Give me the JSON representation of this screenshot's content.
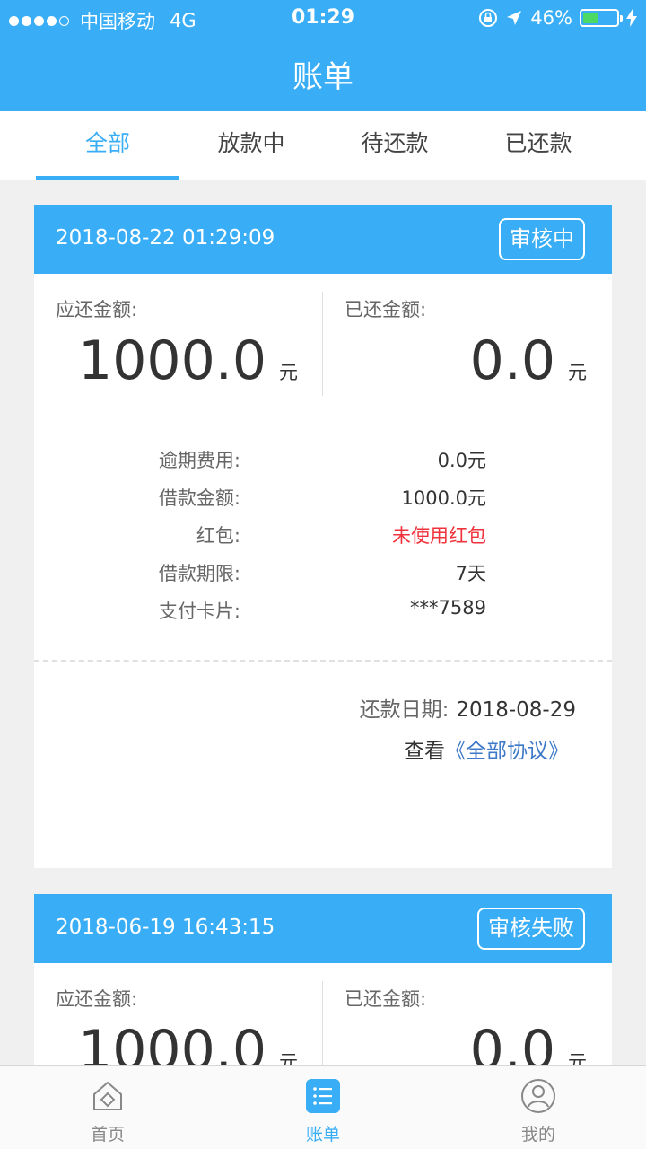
{
  "status_bar": {
    "carrier": "中国移动",
    "network": "4G",
    "time": "01:29",
    "battery": "46%"
  },
  "header": {
    "title": "账单"
  },
  "tabs": [
    {
      "label": "全部",
      "active": true
    },
    {
      "label": "放款中",
      "active": false
    },
    {
      "label": "待还款",
      "active": false
    },
    {
      "label": "已还款",
      "active": false
    }
  ],
  "bills": [
    {
      "datetime": "2018-08-22 01:29:09",
      "status": "审核中",
      "due_label": "应还金额:",
      "due_amount": "1000.0",
      "due_unit": "元",
      "paid_label": "已还金额:",
      "paid_amount": "0.0",
      "paid_unit": "元",
      "details": [
        {
          "label": "逾期费用:",
          "value": "0.0元"
        },
        {
          "label": "借款金额:",
          "value": "1000.0元"
        },
        {
          "label": "红包:",
          "value": "未使用红包"
        },
        {
          "label": "借款期限:",
          "value": "7天"
        },
        {
          "label": "支付卡片:",
          "value": "***7589"
        }
      ],
      "repay_label": "还款日期:",
      "repay_date": "2018-08-29",
      "protocol_prefix": "查看",
      "protocol_link": "《全部协议》"
    },
    {
      "datetime": "2018-06-19 16:43:15",
      "status": "审核失败",
      "due_label": "应还金额:",
      "due_amount": "1000.0",
      "due_unit": "元",
      "paid_label": "已还金额:",
      "paid_amount": "0.0",
      "paid_unit": "元"
    }
  ],
  "bottom_nav": [
    {
      "label": "首页",
      "icon": "home-icon",
      "active": false
    },
    {
      "label": "账单",
      "icon": "bill-list-icon",
      "active": true
    },
    {
      "label": "我的",
      "icon": "user-icon",
      "active": false
    }
  ],
  "colors": {
    "primary": "#39aef6",
    "red": "#f0323c",
    "link": "#3e79c8",
    "battery": "#4cd964"
  }
}
